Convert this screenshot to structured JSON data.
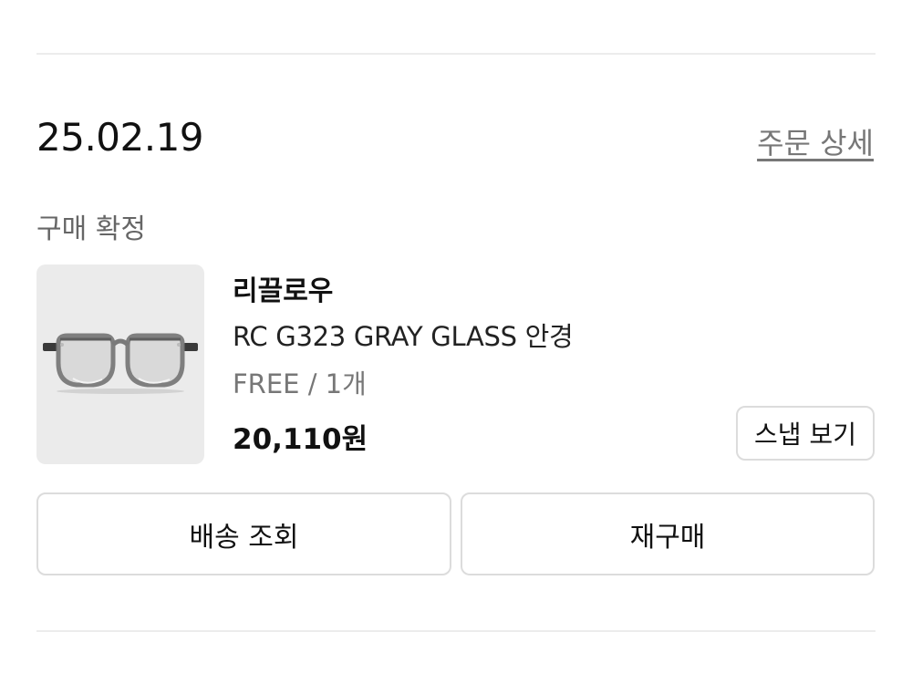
{
  "order": {
    "date": "25.02.19",
    "detail_link": "주문 상세",
    "status": "구매 확정"
  },
  "product": {
    "brand": "리끌로우",
    "name": "RC G323 GRAY GLASS 안경",
    "option": "FREE / 1개",
    "price": "20,110원",
    "image_icon": "eyeglasses-gray-frame",
    "snap_button": "스냅 보기"
  },
  "actions": {
    "track_delivery": "배송 조회",
    "rebuy": "재구매"
  },
  "colors": {
    "thumb_bg": "#ebebeb",
    "frame": "#6f6f6f",
    "border": "#dcdcdc",
    "muted_text": "#777777"
  }
}
